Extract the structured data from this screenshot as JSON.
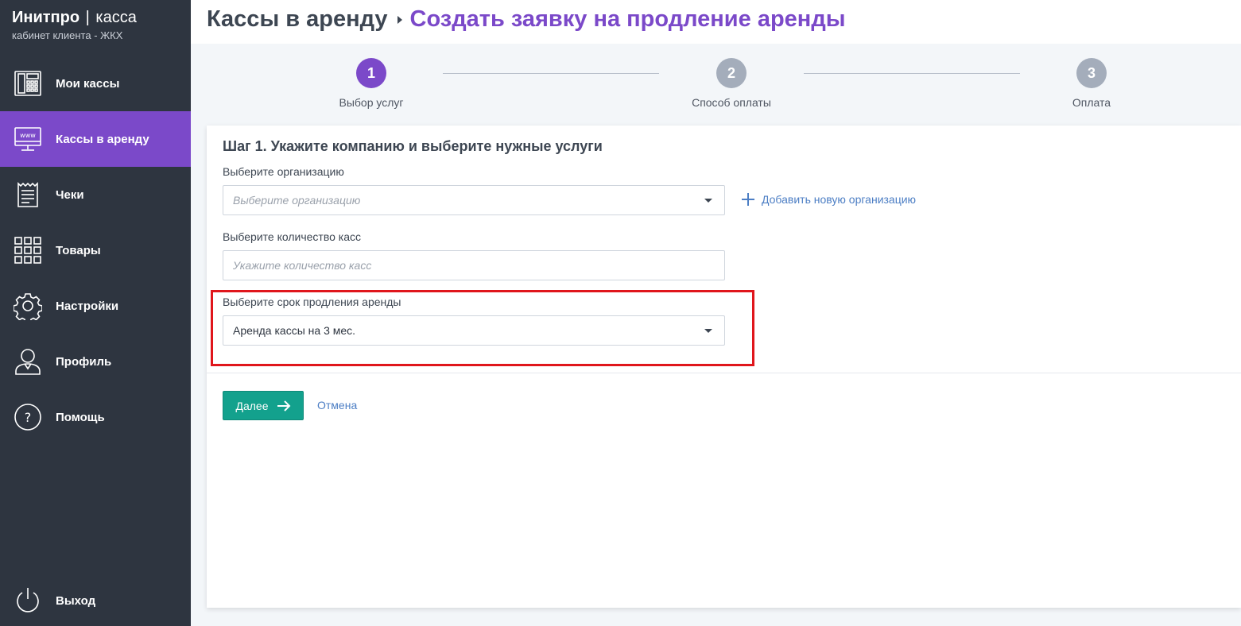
{
  "brand": {
    "name": "Инитпро",
    "separator": "|",
    "product": "касса",
    "subtitle": "кабинет клиента - ЖКХ"
  },
  "sidebar": {
    "items": [
      {
        "label": "Мои кассы",
        "icon": "cash-register-icon"
      },
      {
        "label": "Кассы в аренду",
        "icon": "www-monitor-icon",
        "active": true
      },
      {
        "label": "Чеки",
        "icon": "receipt-icon"
      },
      {
        "label": "Товары",
        "icon": "grid-icon"
      },
      {
        "label": "Настройки",
        "icon": "gear-icon"
      },
      {
        "label": "Профиль",
        "icon": "user-icon"
      },
      {
        "label": "Помощь",
        "icon": "help-icon"
      }
    ],
    "logout": {
      "label": "Выход",
      "icon": "power-icon"
    }
  },
  "header": {
    "root": "Кассы в аренду",
    "current": "Создать заявку на продление аренды"
  },
  "stepper": {
    "steps": [
      {
        "number": "1",
        "label": "Выбор услуг",
        "active": true
      },
      {
        "number": "2",
        "label": "Способ оплаты",
        "active": false
      },
      {
        "number": "3",
        "label": "Оплата",
        "active": false
      }
    ]
  },
  "form": {
    "title": "Шаг 1. Укажите компанию и выберите нужные услуги",
    "organization": {
      "label": "Выберите организацию",
      "placeholder": "Выберите организацию"
    },
    "add_organization": "Добавить новую организацию",
    "quantity": {
      "label": "Выберите количество касс",
      "placeholder": "Укажите количество касс"
    },
    "term": {
      "label": "Выберите срок продления аренды",
      "value": "Аренда кассы на 3 мес."
    },
    "next_button": "Далее",
    "cancel_link": "Отмена"
  },
  "colors": {
    "sidebar_bg": "#2e3540",
    "accent": "#7b49c9",
    "primary_button": "#13a18d",
    "link": "#4c7ec4",
    "highlight_border": "#e0161c"
  }
}
